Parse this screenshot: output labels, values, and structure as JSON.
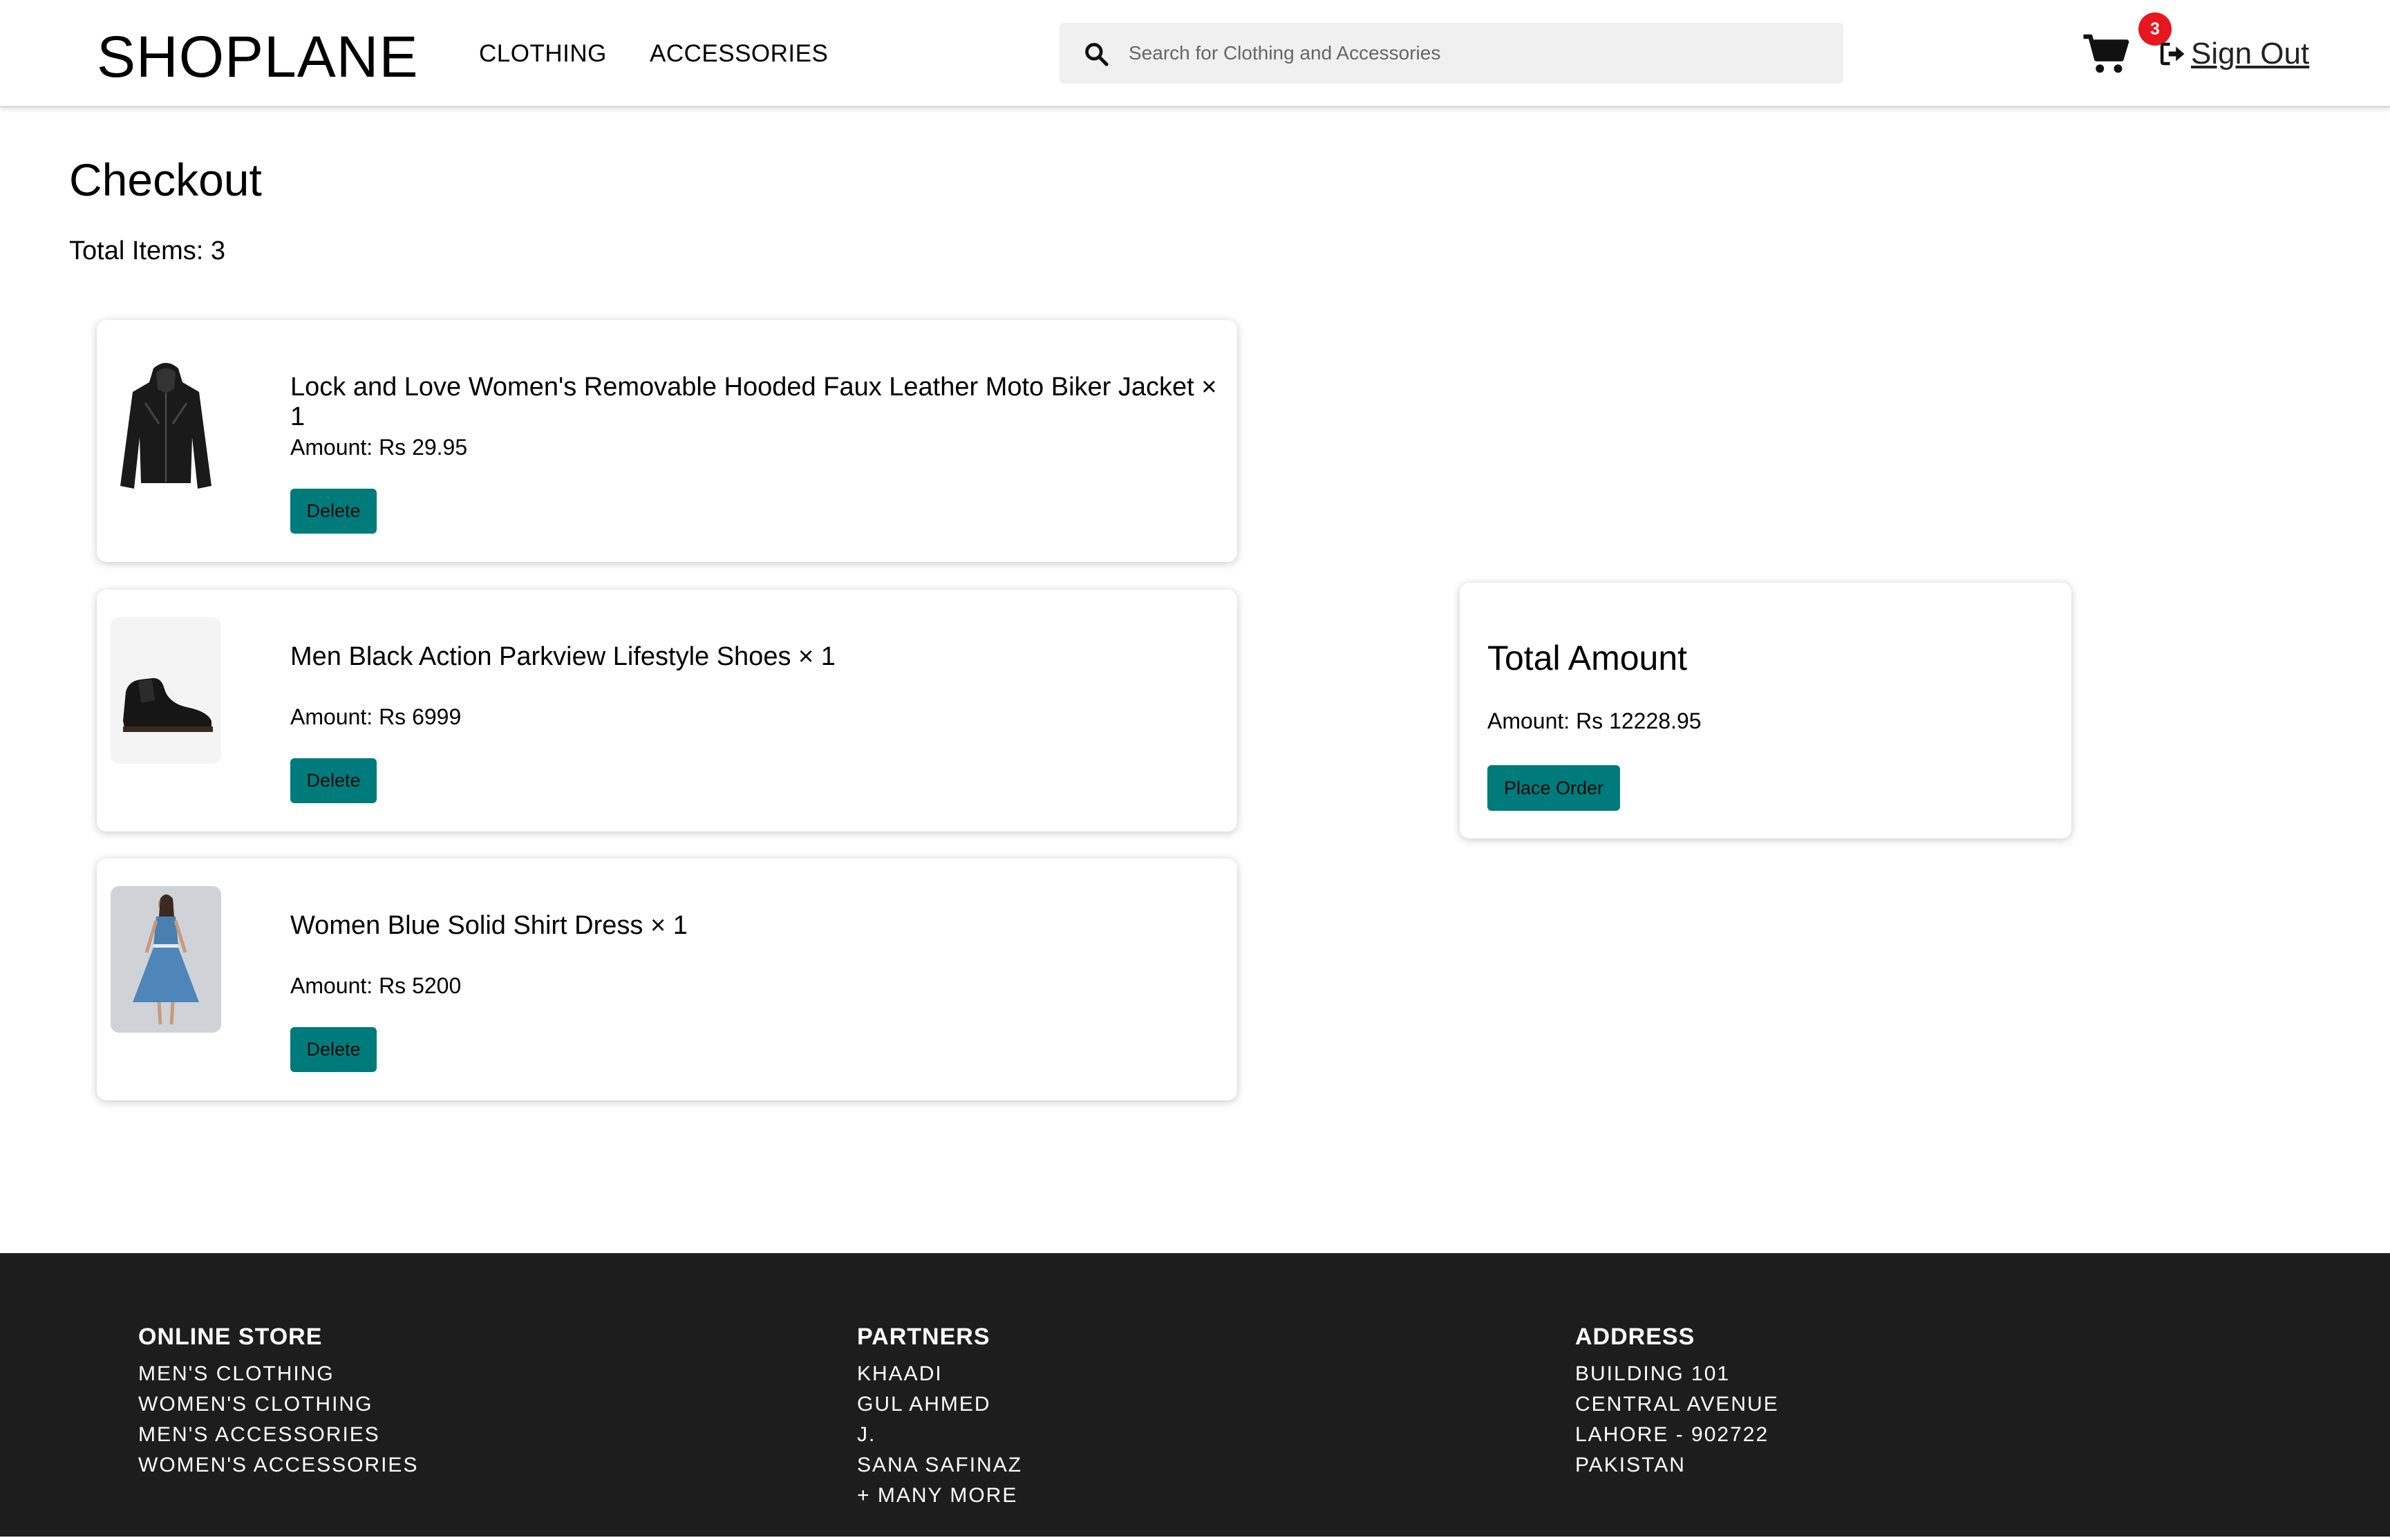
{
  "header": {
    "logo": "SHOPLANE",
    "nav": {
      "clothing": "CLOTHING",
      "accessories": "ACCESSORIES"
    },
    "search_placeholder": "Search for Clothing and Accessories",
    "cart_count": "3",
    "signout_label": "Sign Out"
  },
  "page": {
    "title": "Checkout",
    "total_items": "Total Items: 3"
  },
  "cart_items": [
    {
      "name": "Lock and Love Women's Removable Hooded Faux Leather Moto Biker Jacket × 1",
      "amount": "Amount: Rs 29.95",
      "delete_label": "Delete",
      "image": "black-leather-jacket"
    },
    {
      "name": "Men Black Action Parkview Lifestyle Shoes × 1",
      "amount": "Amount: Rs 6999",
      "delete_label": "Delete",
      "image": "black-chelsea-boot"
    },
    {
      "name": "Women Blue Solid Shirt Dress × 1",
      "amount": "Amount: Rs 5200",
      "delete_label": "Delete",
      "image": "blue-shirt-dress"
    }
  ],
  "summary": {
    "title": "Total Amount",
    "amount": "Amount: Rs 12228.95",
    "place_order_label": "Place Order"
  },
  "footer": {
    "online_store": {
      "title": "ONLINE STORE",
      "items": [
        "MEN'S CLOTHING",
        "WOMEN'S CLOTHING",
        "MEN'S ACCESSORIES",
        "WOMEN'S ACCESSORIES"
      ]
    },
    "partners": {
      "title": "PARTNERS",
      "items": [
        "KHAADI",
        "GUL AHMED",
        "J.",
        "SANA SAFINAZ",
        "+ MANY MORE"
      ]
    },
    "address": {
      "title": "ADDRESS",
      "items": [
        "BUILDING 101",
        "CENTRAL AVENUE",
        "LAHORE - 902722",
        "PAKISTAN"
      ]
    }
  },
  "colors": {
    "accent": "#007b7b",
    "badge": "#e8161e",
    "footer_bg": "#1d1d1d"
  }
}
